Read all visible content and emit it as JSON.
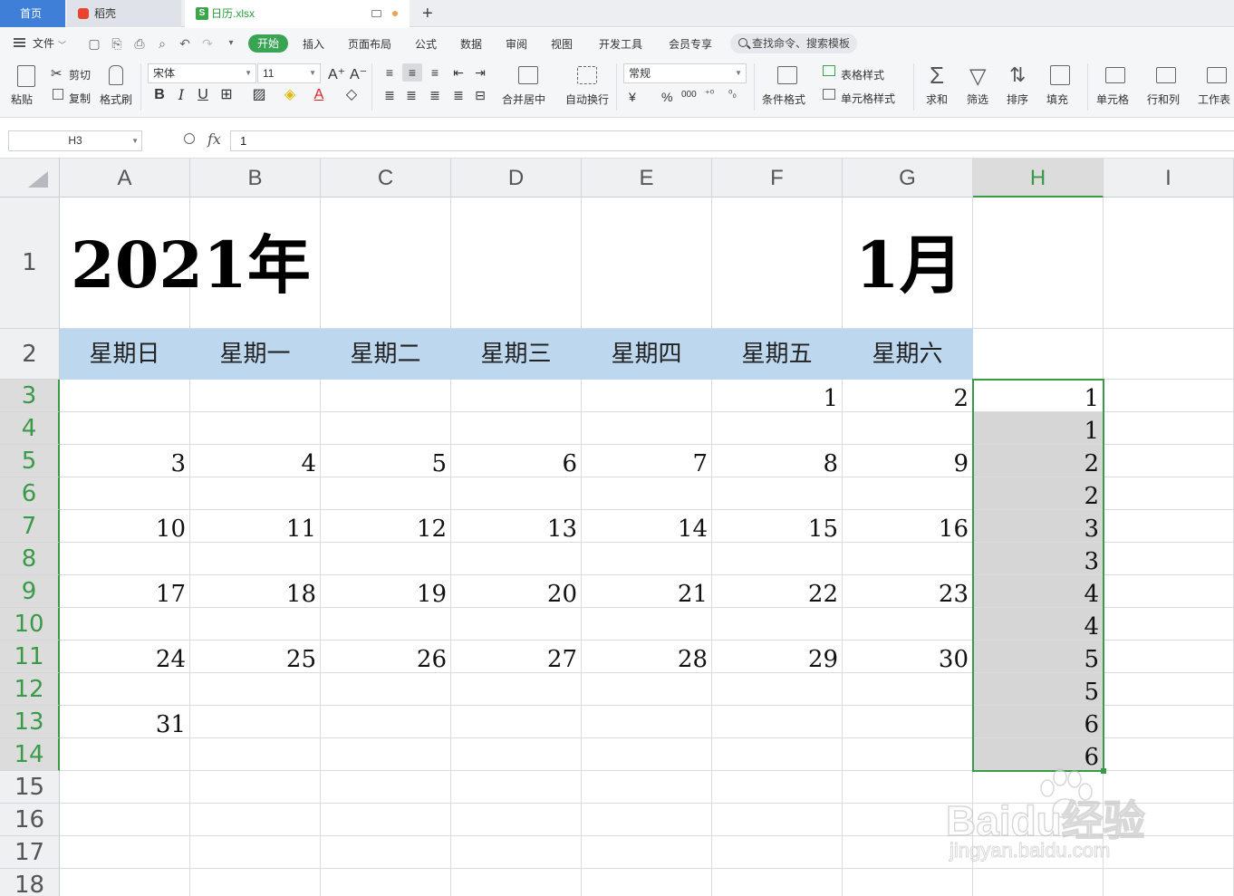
{
  "tabs": {
    "home": "首页",
    "daoke": "稻壳",
    "file": "日历.xlsx",
    "file_icon": "S",
    "add": "+"
  },
  "menu": {
    "file": "文件",
    "start": "开始",
    "items": [
      "插入",
      "页面布局",
      "公式",
      "数据",
      "审阅",
      "视图",
      "开发工具",
      "会员专享"
    ],
    "search": "查找命令、搜索模板"
  },
  "ribbon": {
    "paste": "粘贴",
    "cut": "剪切",
    "copy": "复制",
    "format_painter": "格式刷",
    "font_name": "宋体",
    "font_size": "11",
    "merge_center": "合并居中",
    "wrap_text": "自动换行",
    "number_format": "常规",
    "cond_format": "条件格式",
    "table_style": "表格样式",
    "cell_style": "单元格样式",
    "sum": "求和",
    "filter": "筛选",
    "sort": "排序",
    "fill": "填充",
    "cell": "单元格",
    "row_col": "行和列",
    "worksheet": "工作表",
    "font_buttons": [
      "B",
      "I",
      "U"
    ],
    "font_grow": "A⁺",
    "font_shrink": "A⁻",
    "currency": "¥",
    "percent": "%",
    "thousands": "000"
  },
  "formula_bar": {
    "name_box": "H3",
    "fx": "fx",
    "value": "1"
  },
  "sheet": {
    "columns": [
      "A",
      "B",
      "C",
      "D",
      "E",
      "F",
      "G",
      "H",
      "I"
    ],
    "selected_column": "H",
    "rows": [
      "1",
      "2",
      "3",
      "4",
      "5",
      "6",
      "7",
      "8",
      "9",
      "10",
      "11",
      "12",
      "13",
      "14",
      "15",
      "16",
      "17",
      "18"
    ],
    "selected_rows": [
      "3",
      "4",
      "5",
      "6",
      "7",
      "8",
      "9",
      "10",
      "11",
      "12",
      "13",
      "14"
    ],
    "title_year": "2021年",
    "title_month": "1月",
    "weekdays": [
      "星期日",
      "星期一",
      "星期二",
      "星期三",
      "星期四",
      "星期五",
      "星期六"
    ],
    "weekday_header_color": "#bdd7ee",
    "calendar_rows": [
      {
        "row": "3",
        "cells": [
          "",
          "",
          "",
          "",
          "",
          "1",
          "2"
        ]
      },
      {
        "row": "5",
        "cells": [
          "3",
          "4",
          "5",
          "6",
          "7",
          "8",
          "9"
        ]
      },
      {
        "row": "7",
        "cells": [
          "10",
          "11",
          "12",
          "13",
          "14",
          "15",
          "16"
        ]
      },
      {
        "row": "9",
        "cells": [
          "17",
          "18",
          "19",
          "20",
          "21",
          "22",
          "23"
        ]
      },
      {
        "row": "11",
        "cells": [
          "24",
          "25",
          "26",
          "27",
          "28",
          "29",
          "30"
        ]
      },
      {
        "row": "13",
        "cells": [
          "31",
          "",
          "",
          "",
          "",
          "",
          ""
        ]
      }
    ],
    "column_h_values": [
      "1",
      "1",
      "2",
      "2",
      "3",
      "3",
      "4",
      "4",
      "5",
      "5",
      "6",
      "6"
    ],
    "selection_color": "#3a9a48",
    "selection_range": "H3:H14"
  },
  "watermark": {
    "line1": "Baidu经验",
    "line2": "jingyan.baidu.com"
  }
}
